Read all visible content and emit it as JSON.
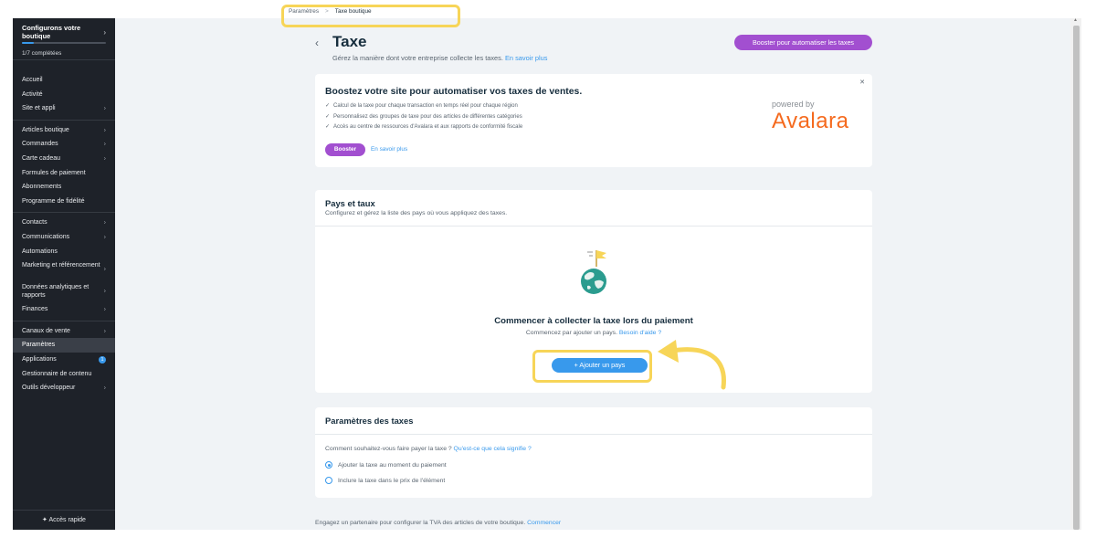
{
  "sidebar": {
    "setup_title": "Configurons votre boutique",
    "setup_progress": 0.1428,
    "setup_count": "1/7 complétées",
    "groups": [
      [
        {
          "label": "Accueil"
        },
        {
          "label": "Activité"
        },
        {
          "label": "Site et appli",
          "chevron": true
        }
      ],
      [
        {
          "label": "Articles boutique",
          "chevron": true
        },
        {
          "label": "Commandes",
          "chevron": true
        },
        {
          "label": "Carte cadeau",
          "chevron": true
        },
        {
          "label": "Formules de paiement"
        },
        {
          "label": "Abonnements"
        },
        {
          "label": "Programme de fidélité"
        }
      ],
      [
        {
          "label": "Contacts",
          "chevron": true
        },
        {
          "label": "Communications",
          "chevron": true
        },
        {
          "label": "Automations"
        },
        {
          "label": "Marketing et référencement",
          "chevron": true,
          "two": true
        },
        {
          "label": "Données analytiques et rapports",
          "chevron": true,
          "two": true
        },
        {
          "label": "Finances",
          "chevron": true
        }
      ],
      [
        {
          "label": "Canaux de vente",
          "chevron": true
        },
        {
          "label": "Paramètres",
          "active": true
        },
        {
          "label": "Applications",
          "badge": "1"
        },
        {
          "label": "Gestionnaire de contenu"
        },
        {
          "label": "Outils développeur",
          "chevron": true
        }
      ]
    ],
    "quick_access": "Accès rapide"
  },
  "breadcrumb": {
    "parent": "Paramètres",
    "current": "Taxe boutique"
  },
  "header": {
    "title": "Taxe",
    "subtitle": "Gérez la manière dont votre entreprise collecte les taxes.",
    "subtitle_link": "En savoir plus",
    "boost_button": "Booster pour automatiser les taxes"
  },
  "promo": {
    "title": "Boostez votre site pour automatiser vos taxes de ventes.",
    "bullets": [
      "Calcul de la taxe pour chaque transaction en temps réel pour chaque région",
      "Personnalisez des groupes de taxe pour des articles de différentes catégories",
      "Accès au centre de ressources d'Avalara et aux rapports de conformité fiscale"
    ],
    "booster_button": "Booster",
    "learn_more": "En savoir plus",
    "powered_by": "powered by",
    "brand": "Avalara"
  },
  "countries": {
    "title": "Pays et taux",
    "description": "Configurez et gérez la liste des pays où vous appliquez des taxes.",
    "empty_title": "Commencer à collecter la taxe lors du paiement",
    "empty_desc": "Commencez par ajouter un pays.",
    "help_link": "Besoin d'aide ?",
    "add_button": "+ Ajouter un pays"
  },
  "tax_settings": {
    "title": "Paramètres des taxes",
    "question": "Comment souhaitez-vous faire payer la taxe ?",
    "question_link": "Qu'est-ce que cela signifie ?",
    "options": [
      {
        "label": "Ajouter la taxe au moment du paiement",
        "selected": true
      },
      {
        "label": "Inclure la taxe dans le prix de l'élément",
        "selected": false
      }
    ]
  },
  "footer": {
    "text": "Engagez un partenaire pour configurer la TVA des articles de votre boutique.",
    "link": "Commencer"
  },
  "colors": {
    "highlight": "#f7d558",
    "accent_blue": "#3899ec",
    "accent_purple": "#a24fd0",
    "avalara_orange": "#f56a1e",
    "sidebar_bg": "#1e2229"
  }
}
